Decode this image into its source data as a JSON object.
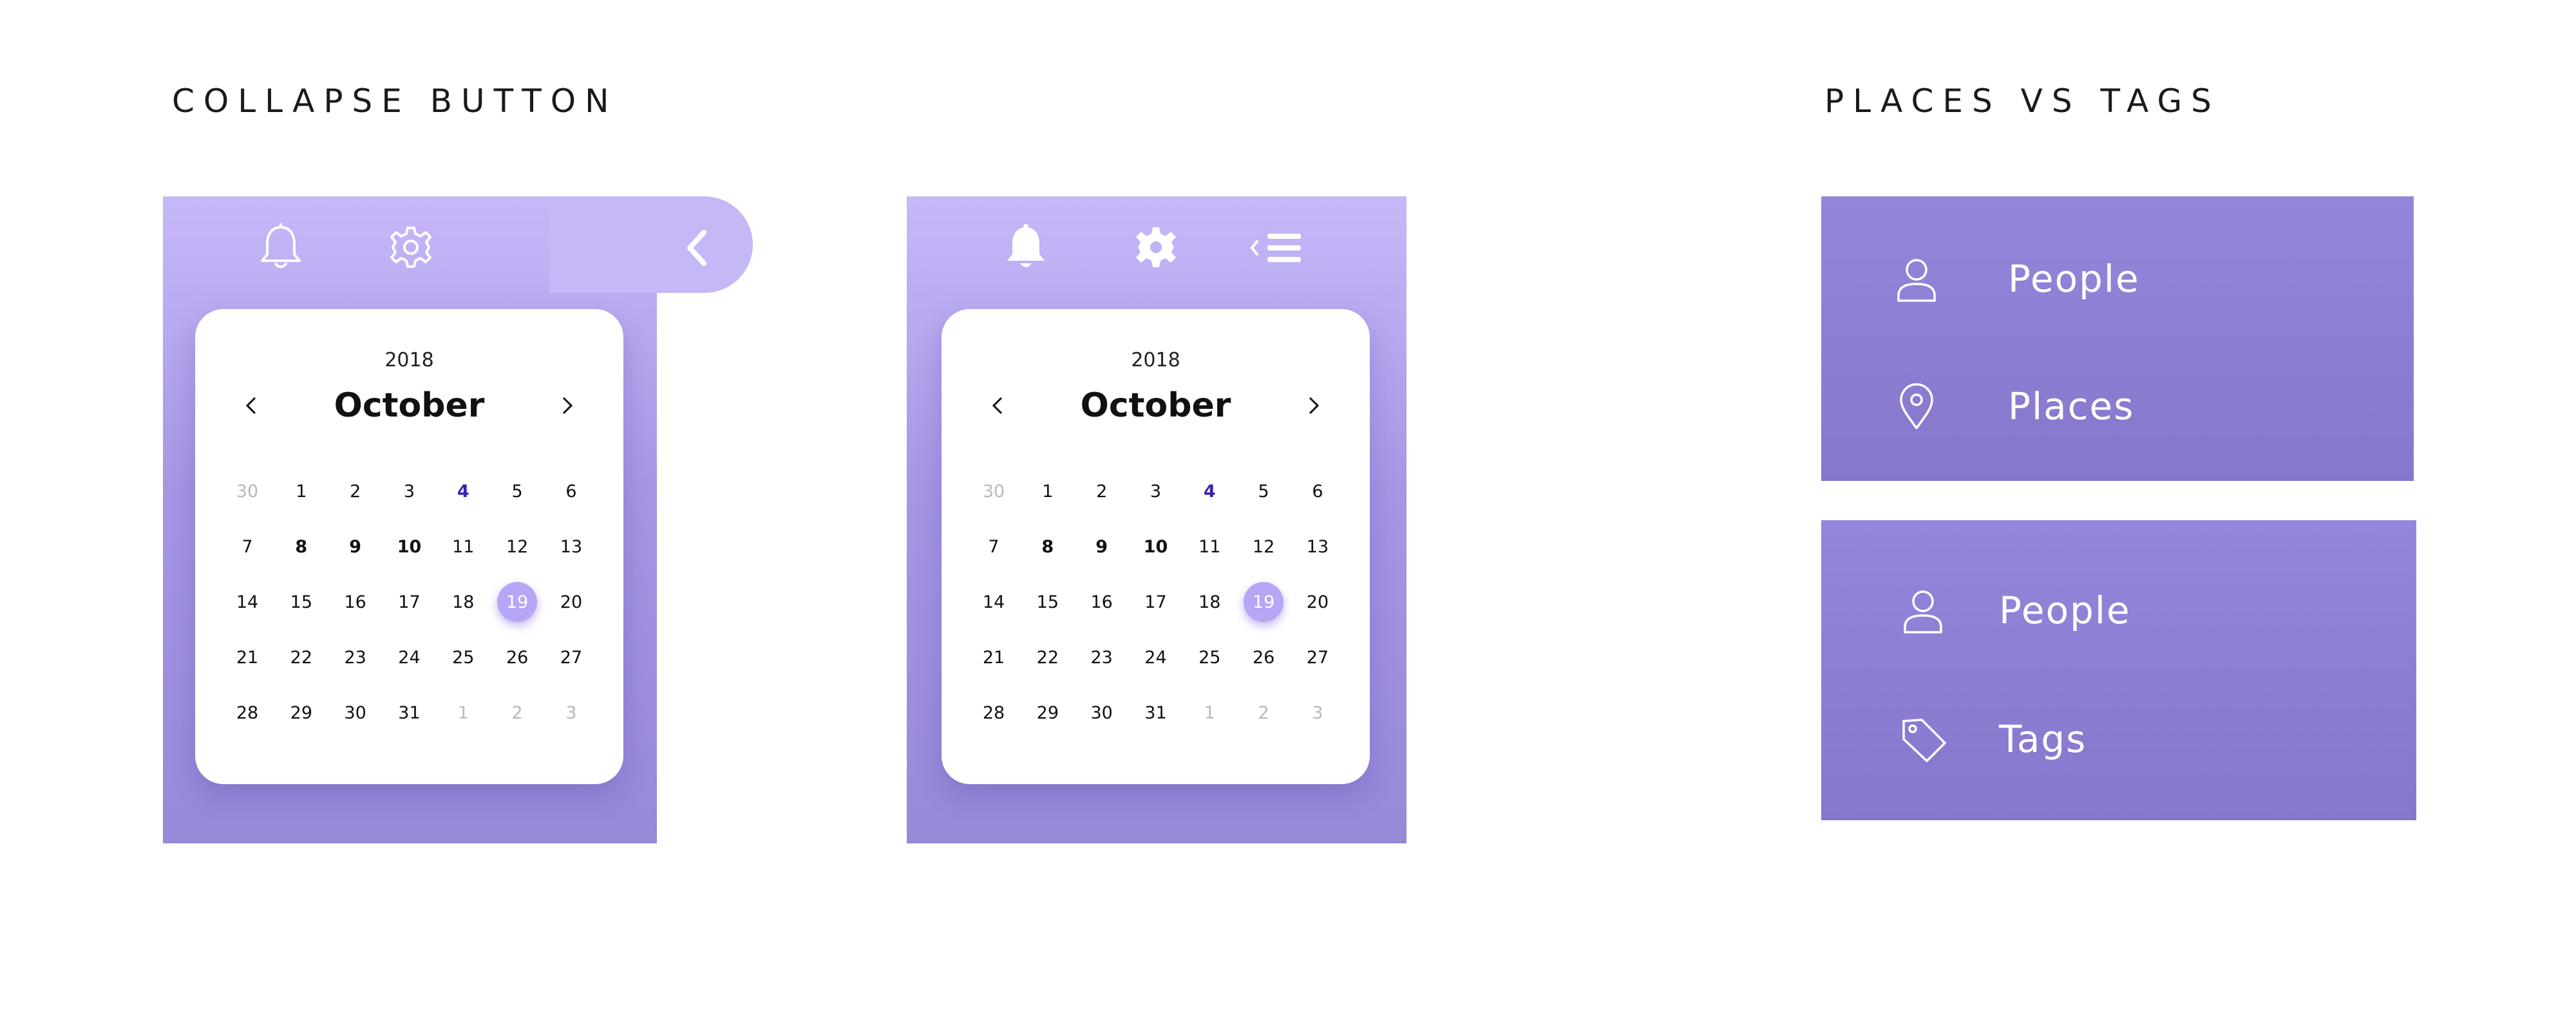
{
  "headings": {
    "collapse": "COLLAPSE BUTTON",
    "places": "PLACES VS TAGS"
  },
  "calendar": {
    "year": "2018",
    "month": "October",
    "weeks": [
      [
        {
          "d": "30",
          "s": "muted"
        },
        {
          "d": "1",
          "s": ""
        },
        {
          "d": "2",
          "s": ""
        },
        {
          "d": "3",
          "s": ""
        },
        {
          "d": "4",
          "s": "accent"
        },
        {
          "d": "5",
          "s": ""
        },
        {
          "d": "6",
          "s": ""
        }
      ],
      [
        {
          "d": "7",
          "s": ""
        },
        {
          "d": "8",
          "s": "bold"
        },
        {
          "d": "9",
          "s": "bold"
        },
        {
          "d": "10",
          "s": "bold"
        },
        {
          "d": "11",
          "s": ""
        },
        {
          "d": "12",
          "s": ""
        },
        {
          "d": "13",
          "s": ""
        }
      ],
      [
        {
          "d": "14",
          "s": ""
        },
        {
          "d": "15",
          "s": ""
        },
        {
          "d": "16",
          "s": ""
        },
        {
          "d": "17",
          "s": ""
        },
        {
          "d": "18",
          "s": ""
        },
        {
          "d": "19",
          "s": "sel"
        },
        {
          "d": "20",
          "s": ""
        }
      ],
      [
        {
          "d": "21",
          "s": ""
        },
        {
          "d": "22",
          "s": ""
        },
        {
          "d": "23",
          "s": ""
        },
        {
          "d": "24",
          "s": ""
        },
        {
          "d": "25",
          "s": ""
        },
        {
          "d": "26",
          "s": ""
        },
        {
          "d": "27",
          "s": ""
        }
      ],
      [
        {
          "d": "28",
          "s": ""
        },
        {
          "d": "29",
          "s": ""
        },
        {
          "d": "30",
          "s": ""
        },
        {
          "d": "31",
          "s": ""
        },
        {
          "d": "1",
          "s": "muted"
        },
        {
          "d": "2",
          "s": "muted"
        },
        {
          "d": "3",
          "s": "muted"
        }
      ]
    ]
  },
  "panel1": {
    "icons": [
      "bell-outline-icon",
      "gear-outline-icon",
      "chevron-left-icon"
    ]
  },
  "panel2": {
    "icons": [
      "bell-filled-icon",
      "gear-filled-icon",
      "collapse-menu-icon"
    ]
  },
  "box1": {
    "items": [
      {
        "label": "People",
        "icon": "person-icon"
      },
      {
        "label": "Places",
        "icon": "location-pin-icon"
      }
    ]
  },
  "box2": {
    "items": [
      {
        "label": "People",
        "icon": "person-icon"
      },
      {
        "label": "Tags",
        "icon": "tag-icon"
      }
    ]
  },
  "colors": {
    "panel_top": "#c7b8f9",
    "panel_bottom": "#9888d8",
    "box": "#8a7bd0",
    "selected_day": "#b7a5f6",
    "accent_day": "#3b1fb0"
  }
}
